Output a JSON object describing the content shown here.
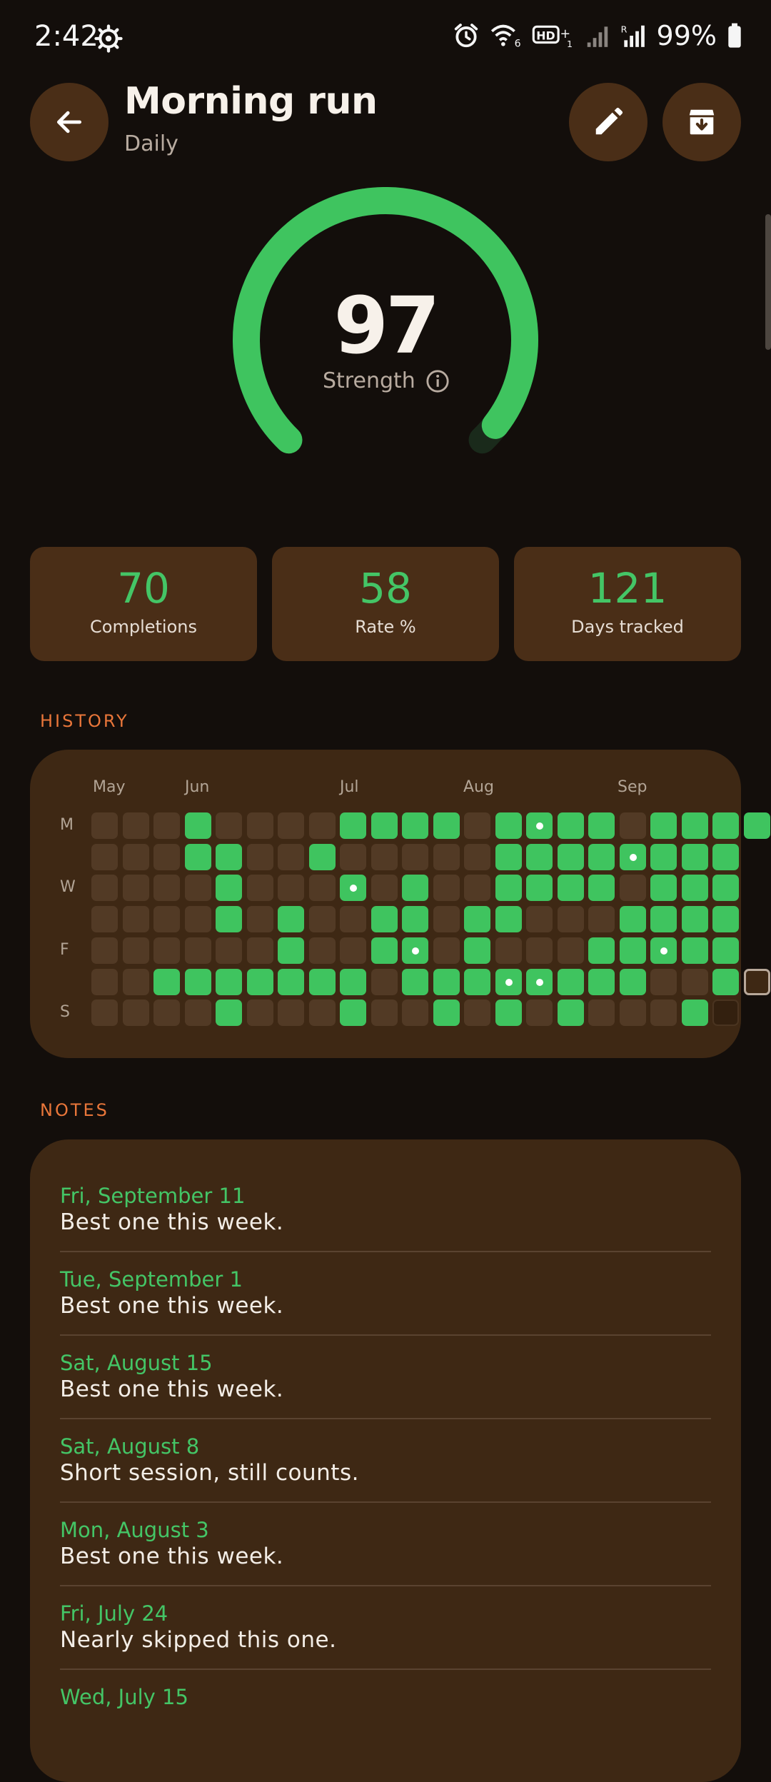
{
  "status_bar": {
    "time": "2:42",
    "battery": "99%"
  },
  "header": {
    "title": "Morning run",
    "subtitle": "Daily"
  },
  "gauge": {
    "value": "97",
    "label": "Strength",
    "fraction": 0.97
  },
  "stats": [
    {
      "value": "70",
      "label": "Completions"
    },
    {
      "value": "58",
      "label": "Rate %"
    },
    {
      "value": "121",
      "label": "Days tracked"
    }
  ],
  "history": {
    "section_label": "HISTORY",
    "months": [
      "May",
      "Jun",
      "Jul",
      "Aug",
      "Sep"
    ],
    "weekday_labels": [
      "M",
      "W",
      "F",
      "S"
    ],
    "grid": [
      "...x....xxxx.x*xx.xxxx",
      "...xx..x.....xxxx*xxx",
      "....x...*.x..xxxx.xxx",
      "....x.x..xx.xx...xxxx",
      "......x..x*.x...xx*xx",
      "..xxxxxxx.xxx**xxx..xT",
      "....x...x..x.x.x...xF"
    ]
  },
  "notes": {
    "section_label": "NOTES",
    "items": [
      {
        "date": "Fri, September 11",
        "text": "Best one this week."
      },
      {
        "date": "Tue, September 1",
        "text": "Best one this week."
      },
      {
        "date": "Sat, August 15",
        "text": "Best one this week."
      },
      {
        "date": "Sat, August 8",
        "text": "Short session, still counts."
      },
      {
        "date": "Mon, August 3",
        "text": "Best one this week."
      },
      {
        "date": "Fri, July 24",
        "text": "Nearly skipped this one."
      },
      {
        "date": "Wed, July 15",
        "text": ""
      }
    ]
  },
  "colors": {
    "accent_green": "#3fc45f",
    "section_orange": "#e9763a",
    "card_brown": "#4a2e17"
  },
  "icons": [
    "settings-icon",
    "alarm-icon",
    "wifi-icon",
    "hd-icon",
    "signal-icon",
    "battery-icon",
    "back-arrow-icon",
    "edit-pencil-icon",
    "archive-icon",
    "info-icon"
  ]
}
